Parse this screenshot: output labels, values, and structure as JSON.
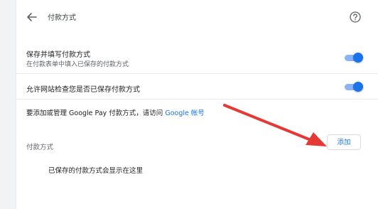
{
  "header": {
    "back_icon": "arrow-left-icon",
    "title": "付款方式",
    "help_icon": "help-circle-icon"
  },
  "settings": [
    {
      "title": "保存并填写付款方式",
      "subtitle": "在付款表单中填入已保存的付款方式",
      "enabled": true
    },
    {
      "title": "允许网站检查您是否已保存付款方式",
      "enabled": true
    }
  ],
  "manage": {
    "text": "要添加或管理 Google Pay 付款方式，请访问",
    "link": "Google 帐号"
  },
  "payment_methods": {
    "label": "付款方式",
    "add_button": "添加",
    "empty_text": "已保存的付款方式会显示在这里"
  },
  "colors": {
    "accent": "#1a73e8",
    "toggle_track": "#8ab4f8",
    "annotation_arrow": "#e53935"
  }
}
